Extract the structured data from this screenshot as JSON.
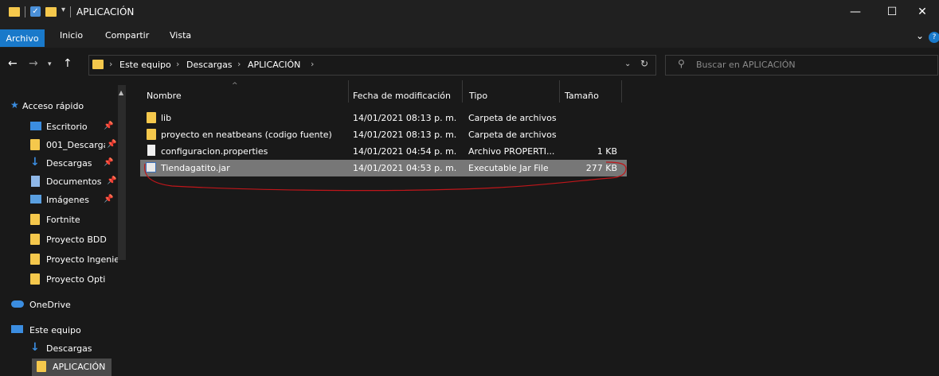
{
  "window": {
    "title": "APLICACIÓN",
    "minimize": "—",
    "maximize": "☐",
    "close": "✕"
  },
  "ribbon": {
    "tabs": [
      "Archivo",
      "Inicio",
      "Compartir",
      "Vista"
    ],
    "active": "Archivo"
  },
  "address": {
    "breadcrumbs": [
      "Este equipo",
      "Descargas",
      "APLICACIÓN"
    ],
    "search_placeholder": "Buscar en APLICACIÓN"
  },
  "columns": [
    "Nombre",
    "Fecha de modificación",
    "Tipo",
    "Tamaño"
  ],
  "sidebar": {
    "quick_access": "Acceso rápido",
    "items": [
      {
        "label": "Escritorio",
        "icon": "desktop-icon",
        "pinned": true
      },
      {
        "label": "001_Descarga",
        "icon": "folder-icon",
        "pinned": true
      },
      {
        "label": "Descargas",
        "icon": "download-icon",
        "pinned": true
      },
      {
        "label": "Documentos",
        "icon": "documents-icon",
        "pinned": true
      },
      {
        "label": "Imágenes",
        "icon": "images-icon",
        "pinned": true
      },
      {
        "label": "Fortnite",
        "icon": "folder-icon",
        "pinned": false
      },
      {
        "label": "Proyecto BDD",
        "icon": "folder-icon",
        "pinned": false
      },
      {
        "label": "Proyecto Ingenie",
        "icon": "folder-icon",
        "pinned": false
      },
      {
        "label": "Proyecto Opti",
        "icon": "folder-icon",
        "pinned": false
      }
    ],
    "onedrive": "OneDrive",
    "this_pc": "Este equipo",
    "pc_items": [
      "Descargas",
      "APLICACIÓN"
    ]
  },
  "files": [
    {
      "name": "lib",
      "date": "14/01/2021 08:13 p. m.",
      "type": "Carpeta de archivos",
      "size": "",
      "icon": "folder-icon",
      "selected": false
    },
    {
      "name": "proyecto en neatbeans (codigo fuente)",
      "date": "14/01/2021 08:13 p. m.",
      "type": "Carpeta de archivos",
      "size": "",
      "icon": "folder-icon",
      "selected": false
    },
    {
      "name": "configuracion.properties",
      "date": "14/01/2021 04:54 p. m.",
      "type": "Archivo PROPERTI...",
      "size": "1 KB",
      "icon": "file-icon",
      "selected": false
    },
    {
      "name": "Tiendagatito.jar",
      "date": "14/01/2021 04:53 p. m.",
      "type": "Executable Jar File",
      "size": "277 KB",
      "icon": "jar-icon",
      "selected": true
    }
  ],
  "colors": {
    "background": "#191919",
    "accent": "#1979ca",
    "folder": "#f5c84c",
    "selection": "#777777",
    "annotation": "#c0161a"
  }
}
